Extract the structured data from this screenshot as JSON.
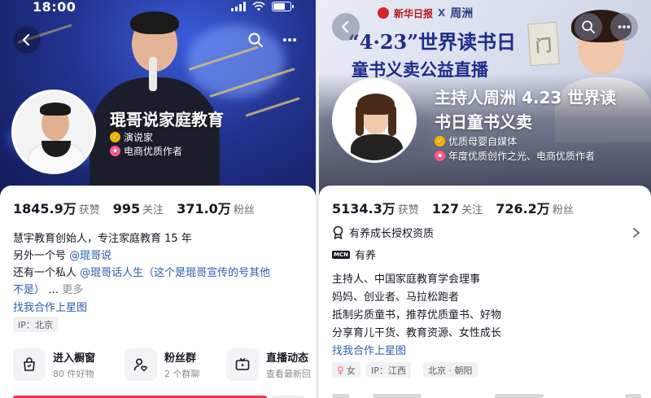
{
  "left": {
    "status": {
      "time": "18:00"
    },
    "profile": {
      "name": "琨哥说家庭教育",
      "badges": [
        {
          "icon": "verified-check-icon",
          "text": "演说家"
        },
        {
          "icon": "star-badge-icon",
          "text": "电商优质作者"
        }
      ]
    },
    "stats": [
      {
        "value": "1845.9万",
        "label": "获赞"
      },
      {
        "value": "995",
        "label": "关注"
      },
      {
        "value": "371.0万",
        "label": "粉丝"
      }
    ],
    "bio": {
      "line1": "慧宇教育创始人，专注家庭教育 15 年",
      "line2_prefix": "另外一个号 ",
      "line2_mention": "@琨哥说",
      "line3_prefix": "还有一个私人 ",
      "line3_mention": "@琨哥话人生（这个是琨哥宣传的号其他",
      "line4_mention": "不是）",
      "line4_ellipsis": " … ",
      "line4_more": "更多",
      "cooperate": "找我合作上星图"
    },
    "ip_tag": "IP：北京",
    "shortcuts": [
      {
        "icon": "shopping-bag-icon",
        "title": "进入橱窗",
        "sub": "80 件好物"
      },
      {
        "icon": "fan-group-icon",
        "title": "粉丝群",
        "sub": "2 个群聊"
      },
      {
        "icon": "live-tv-icon",
        "title": "直播动态",
        "sub": "查看最新回"
      }
    ]
  },
  "right": {
    "banner": {
      "logo_text": "新华日报",
      "cross": "X",
      "partner": "周洲",
      "headline1": "“4·23”世界读书日",
      "headline2": "童书义卖公益直播",
      "book_char": "门"
    },
    "profile": {
      "name_line1": "主持人周洲 4.23 世界读",
      "name_line2": "书日童书义卖",
      "badges": [
        {
          "icon": "verified-check-icon",
          "text": "优质母婴自媒体"
        },
        {
          "icon": "star-badge-icon",
          "text": "年度优质创作之光、电商优质作者"
        }
      ]
    },
    "stats": [
      {
        "value": "5134.3万",
        "label": "获赞"
      },
      {
        "value": "127",
        "label": "关注"
      },
      {
        "value": "726.2万",
        "label": "粉丝"
      }
    ],
    "qualification": "有养成长授权资质",
    "mcn_label": "MCN",
    "mcn_name": "有养",
    "bio_lines": [
      "主持人、中国家庭教育学会理事",
      "妈妈、创业者、马拉松跑者",
      "抵制劣质童书，推荐优质童书、好物",
      "分享育儿干货、教育资源、女性成长"
    ],
    "cooperate": "找我合作上星图",
    "tags": [
      "女",
      "IP：江西",
      "北京 · 朝阳"
    ]
  },
  "colors": {
    "accent": "#fe2c55",
    "link": "#2a5db0",
    "gold": "#f4b400",
    "pink": "#ff5a8a"
  }
}
